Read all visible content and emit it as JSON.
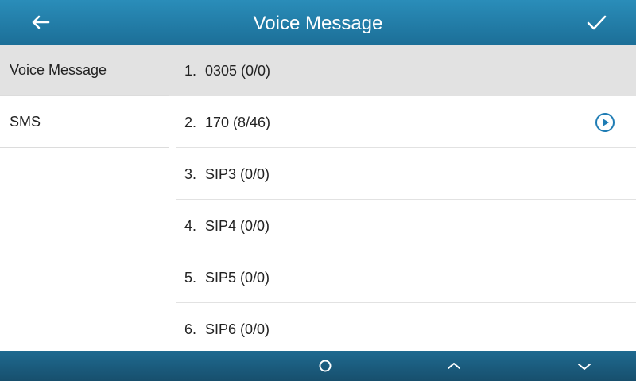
{
  "header": {
    "title": "Voice Message",
    "back_icon": "arrow-left-icon",
    "confirm_icon": "checkmark-icon"
  },
  "sidebar": {
    "items": [
      {
        "label": "Voice Message",
        "active": true
      },
      {
        "label": "SMS",
        "active": false
      }
    ]
  },
  "messages": [
    {
      "num": "1.",
      "label": "0305 (0/0)",
      "active": true,
      "play": false
    },
    {
      "num": "2.",
      "label": "170 (8/46)",
      "active": false,
      "play": true
    },
    {
      "num": "3.",
      "label": "SIP3 (0/0)",
      "active": false,
      "play": false
    },
    {
      "num": "4.",
      "label": "SIP4 (0/0)",
      "active": false,
      "play": false
    },
    {
      "num": "5.",
      "label": "SIP5 (0/0)",
      "active": false,
      "play": false
    },
    {
      "num": "6.",
      "label": "SIP6 (0/0)",
      "active": false,
      "play": false
    }
  ],
  "footer": {
    "buttons": [
      "circle-icon",
      "chevron-up-icon",
      "chevron-down-icon"
    ]
  },
  "colors": {
    "header": "#1c6f98",
    "footer": "#174f6d",
    "accent": "#1e7cb4",
    "selected_row": "#e2e2e2"
  }
}
